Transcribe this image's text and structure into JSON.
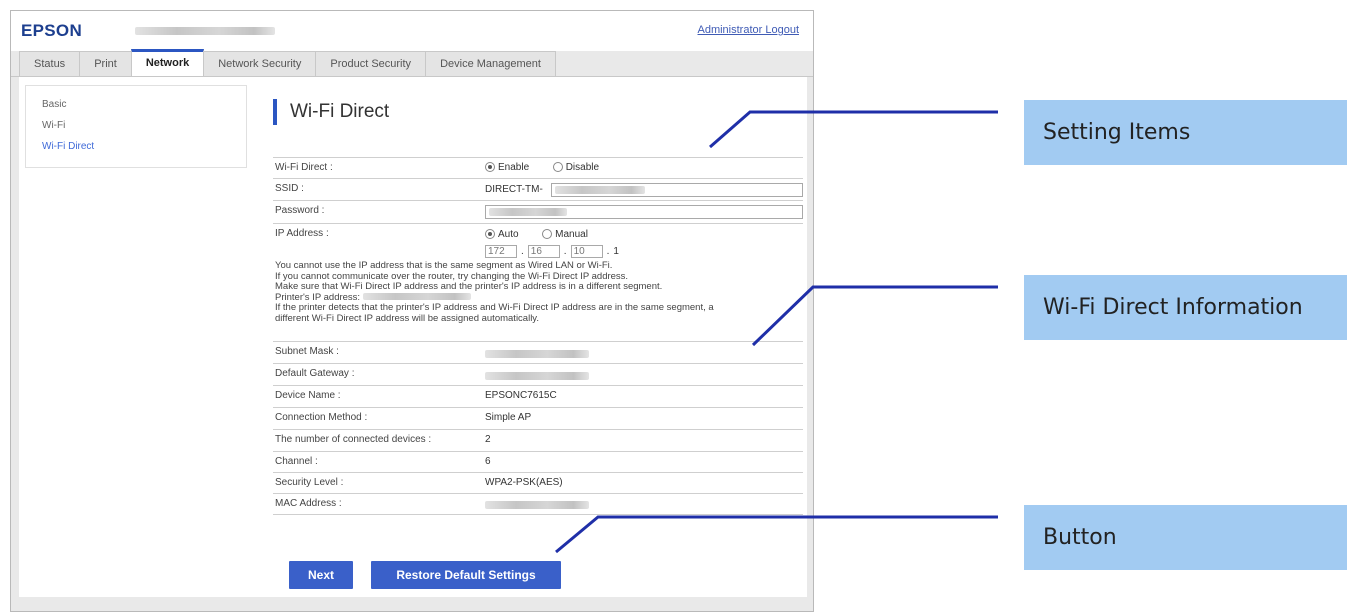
{
  "header": {
    "logo": "EPSON",
    "admin_logout": "Administrator Logout"
  },
  "tabs": [
    {
      "label": "Status"
    },
    {
      "label": "Print"
    },
    {
      "label": "Network",
      "active": true
    },
    {
      "label": "Network Security"
    },
    {
      "label": "Product Security"
    },
    {
      "label": "Device Management"
    }
  ],
  "sidebar": {
    "items": [
      {
        "label": "Basic"
      },
      {
        "label": "Wi-Fi"
      },
      {
        "label": "Wi-Fi Direct",
        "current": true
      }
    ]
  },
  "main": {
    "title": "Wi-Fi Direct",
    "wifi_direct": {
      "label": "Wi-Fi Direct :",
      "enable": "Enable",
      "disable": "Disable",
      "selected": "Enable"
    },
    "ssid": {
      "label": "SSID :",
      "value_prefix": "DIRECT-TM-"
    },
    "password": {
      "label": "Password :"
    },
    "ip_address": {
      "label": "IP Address :",
      "auto": "Auto",
      "manual": "Manual",
      "selected": "Auto",
      "octets": [
        "172",
        "16",
        "10",
        "1"
      ]
    },
    "notes": [
      "You cannot use the IP address that is the same segment as Wired LAN or Wi-Fi.",
      "If you cannot communicate over the router, try changing the Wi-Fi Direct IP address.",
      "Make sure that Wi-Fi Direct IP address and the printer's IP address is in a different segment.",
      "Printer's IP address:",
      "If the printer detects that the printer's IP address and Wi-Fi Direct IP address are in the same segment, a",
      "different Wi-Fi Direct IP address will be assigned automatically."
    ],
    "info": {
      "subnet_mask": {
        "label": "Subnet Mask :"
      },
      "default_gateway": {
        "label": "Default Gateway :"
      },
      "device_name": {
        "label": "Device Name :",
        "value": "EPSONC7615C"
      },
      "connection_method": {
        "label": "Connection Method :",
        "value": "Simple AP"
      },
      "connected_devices": {
        "label": "The number of connected devices :",
        "value": "2"
      },
      "channel": {
        "label": "Channel :",
        "value": "6"
      },
      "security_level": {
        "label": "Security Level :",
        "value": "WPA2-PSK(AES)"
      },
      "mac_address": {
        "label": "MAC Address :"
      }
    },
    "buttons": {
      "next": "Next",
      "restore": "Restore Default Settings"
    }
  },
  "callouts": {
    "setting_items": "Setting Items",
    "wifi_direct_information": "Wi-Fi Direct Information",
    "button": "Button"
  },
  "colors": {
    "accent": "#2b56c2",
    "button": "#3a60c9",
    "callout": "#a2cbf2",
    "leader_line": "#1f2fa8"
  }
}
